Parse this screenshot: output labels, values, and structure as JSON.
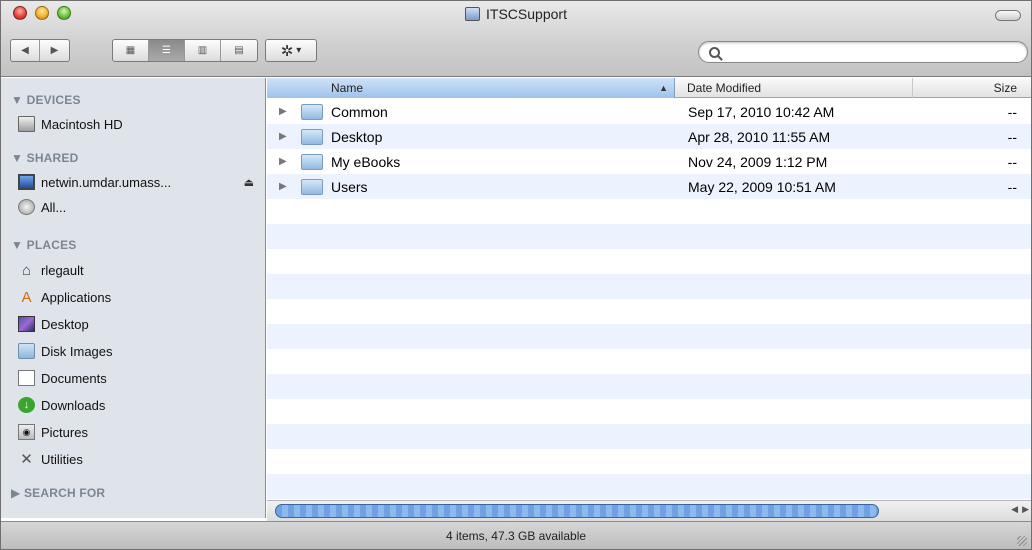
{
  "window": {
    "title": "ITSCSupport"
  },
  "toolbar": {
    "back": "◀",
    "forward": "▶",
    "view_icon": "▦",
    "view_list": "☰",
    "view_columns": "▥",
    "view_coverflow": "▤",
    "action_gear": "✲",
    "action_caret": "▾",
    "search_placeholder": ""
  },
  "sidebar": {
    "sections": [
      {
        "heading": "▼ DEVICES"
      },
      {
        "heading": "▼ SHARED"
      },
      {
        "heading": "▼ PLACES"
      },
      {
        "heading": "▶ SEARCH FOR"
      }
    ],
    "devices": [
      {
        "label": "Macintosh HD",
        "icon": "hard-drive-icon"
      }
    ],
    "shared": [
      {
        "label": "netwin.umdar.umass...",
        "icon": "network-screen-icon"
      },
      {
        "label": "All...",
        "icon": "network-all-icon"
      }
    ],
    "places": [
      {
        "label": "rlegault",
        "icon": "home-icon"
      },
      {
        "label": "Applications",
        "icon": "applications-icon"
      },
      {
        "label": "Desktop",
        "icon": "desktop-icon"
      },
      {
        "label": "Disk Images",
        "icon": "folder-icon"
      },
      {
        "label": "Documents",
        "icon": "documents-icon"
      },
      {
        "label": "Downloads",
        "icon": "downloads-icon"
      },
      {
        "label": "Pictures",
        "icon": "pictures-icon"
      },
      {
        "label": "Utilities",
        "icon": "utilities-icon"
      }
    ],
    "eject": "⏏"
  },
  "list": {
    "columns": {
      "name": "Name",
      "date": "Date Modified",
      "size": "Size"
    },
    "sort_indicator": "▲",
    "rows": [
      {
        "name": "Common",
        "date": "Sep 17, 2010 10:42 AM",
        "size": "--"
      },
      {
        "name": "Desktop",
        "date": "Apr 28, 2010 11:55 AM",
        "size": "--"
      },
      {
        "name": "My eBooks",
        "date": "Nov 24, 2009 1:12 PM",
        "size": "--"
      },
      {
        "name": "Users",
        "date": "May 22, 2009 10:51 AM",
        "size": "--"
      }
    ],
    "disclosure": "▶"
  },
  "status": {
    "text": "4 items, 47.3 GB available"
  }
}
